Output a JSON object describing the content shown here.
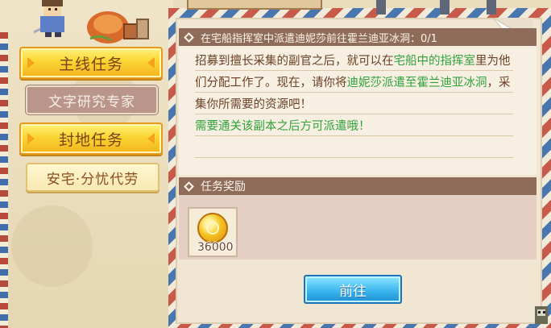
{
  "menu": {
    "items": [
      {
        "label": "主线任务",
        "style": "yellow"
      },
      {
        "label": "文字研究专家",
        "style": "brown"
      },
      {
        "label": "封地任务",
        "style": "yellow"
      },
      {
        "label": "安宅·分忧代劳",
        "style": "cream"
      }
    ]
  },
  "quest": {
    "title": "在宅船指挥室中派遣迪妮莎前往霍兰迪亚冰洞：0/1",
    "desc_part1": "招募到擅长采集的副官之后，就可以在",
    "desc_hl1": "宅船中的指挥室",
    "desc_part2": "里为他们分配工作了。现在，请你将",
    "desc_hl2": "迪妮莎派遣至霍兰迪亚冰洞",
    "desc_part3": "，采集你所需要的资源吧！",
    "note": "需要通关该副本之后方可派遣哦！"
  },
  "reward": {
    "header": "任务奖励",
    "items": [
      {
        "icon": "gold-coin-icon",
        "count": "36000"
      }
    ]
  },
  "actions": {
    "go_label": "前往"
  },
  "colors": {
    "highlight": "#2fa23c",
    "text": "#6b4228",
    "header_bg": "#8f6b5a",
    "go_button": "#3db7ef"
  }
}
